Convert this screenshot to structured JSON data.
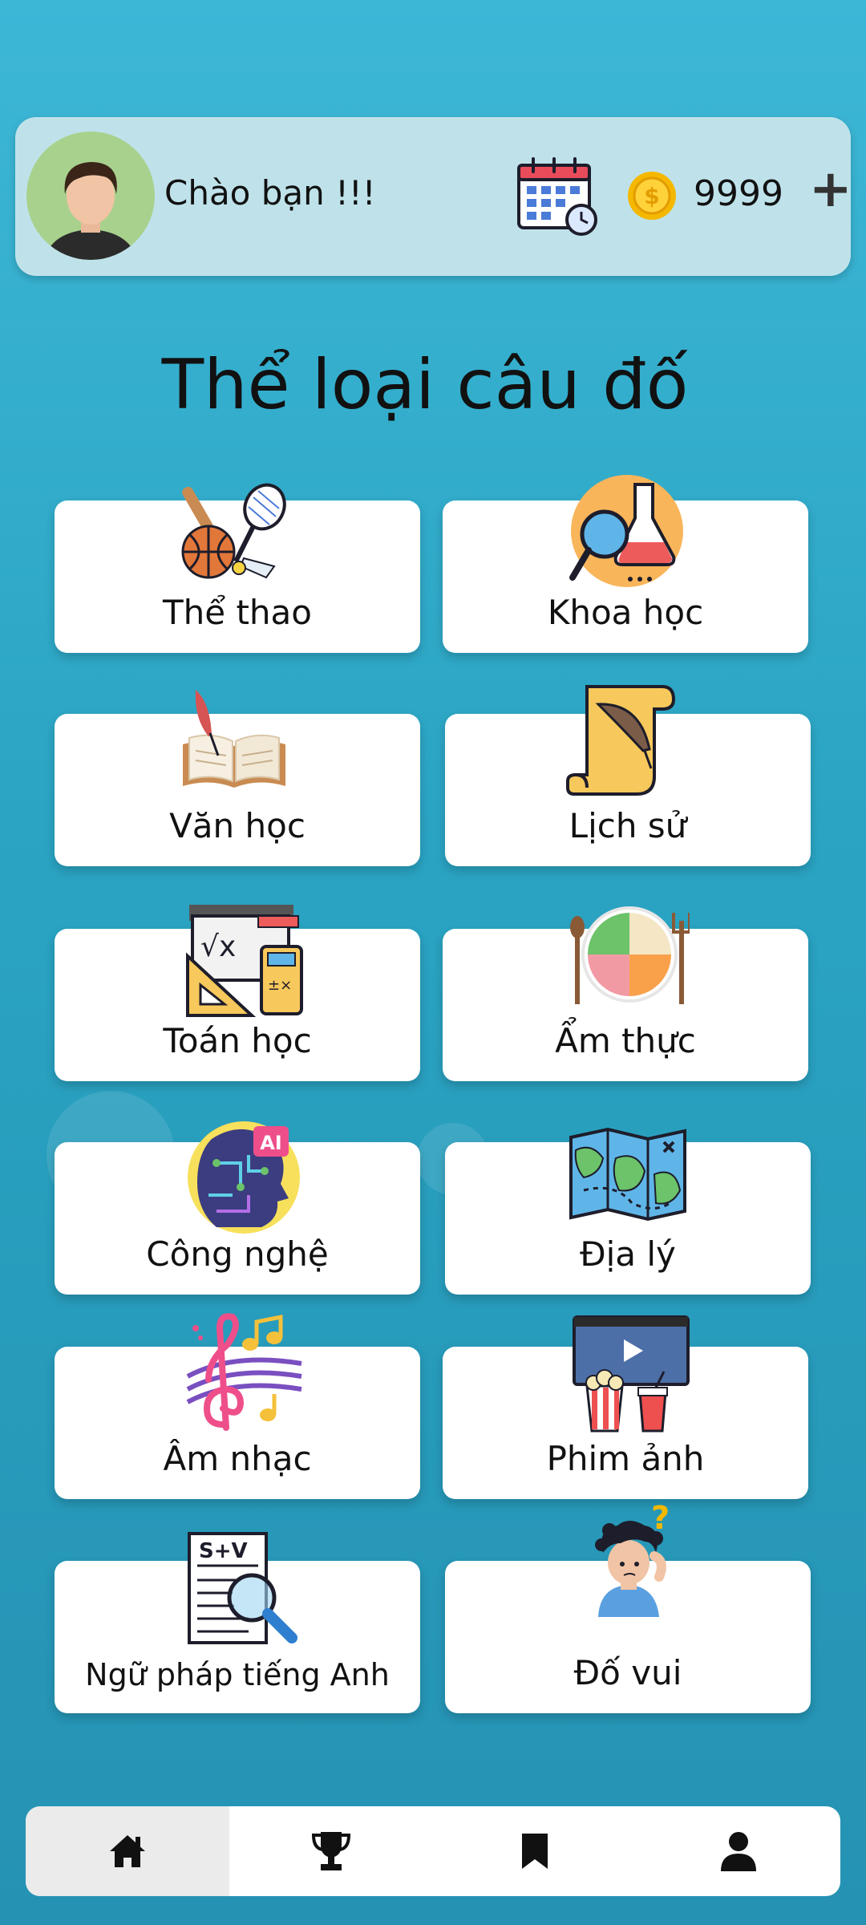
{
  "header": {
    "greeting": "Chào bạn !!!",
    "coins": "9999",
    "plus_label": "+"
  },
  "title": "Thể loại câu đố",
  "categories": [
    {
      "label": "Thể thao",
      "icon": "sports-icon"
    },
    {
      "label": "Khoa học",
      "icon": "science-icon"
    },
    {
      "label": "Văn học",
      "icon": "literature-book-icon"
    },
    {
      "label": "Lịch sử",
      "icon": "history-scroll-icon"
    },
    {
      "label": "Toán học",
      "icon": "math-icon"
    },
    {
      "label": "Ẩm thực",
      "icon": "food-plate-icon"
    },
    {
      "label": "Công nghệ",
      "icon": "ai-technology-icon"
    },
    {
      "label": "Địa lý",
      "icon": "map-icon"
    },
    {
      "label": "Âm nhạc",
      "icon": "music-icon"
    },
    {
      "label": "Phim ảnh",
      "icon": "movie-icon"
    },
    {
      "label": "Ngữ pháp tiếng Anh",
      "icon": "grammar-icon"
    },
    {
      "label": "Đố vui",
      "icon": "thinking-person-icon"
    }
  ],
  "nav": [
    "home-icon",
    "trophy-icon",
    "bookmark-icon",
    "profile-icon"
  ],
  "colors": {
    "background": "#3db7d6",
    "header": "#bfe2ea",
    "card": "#ffffff",
    "coin": "#f5b800"
  }
}
